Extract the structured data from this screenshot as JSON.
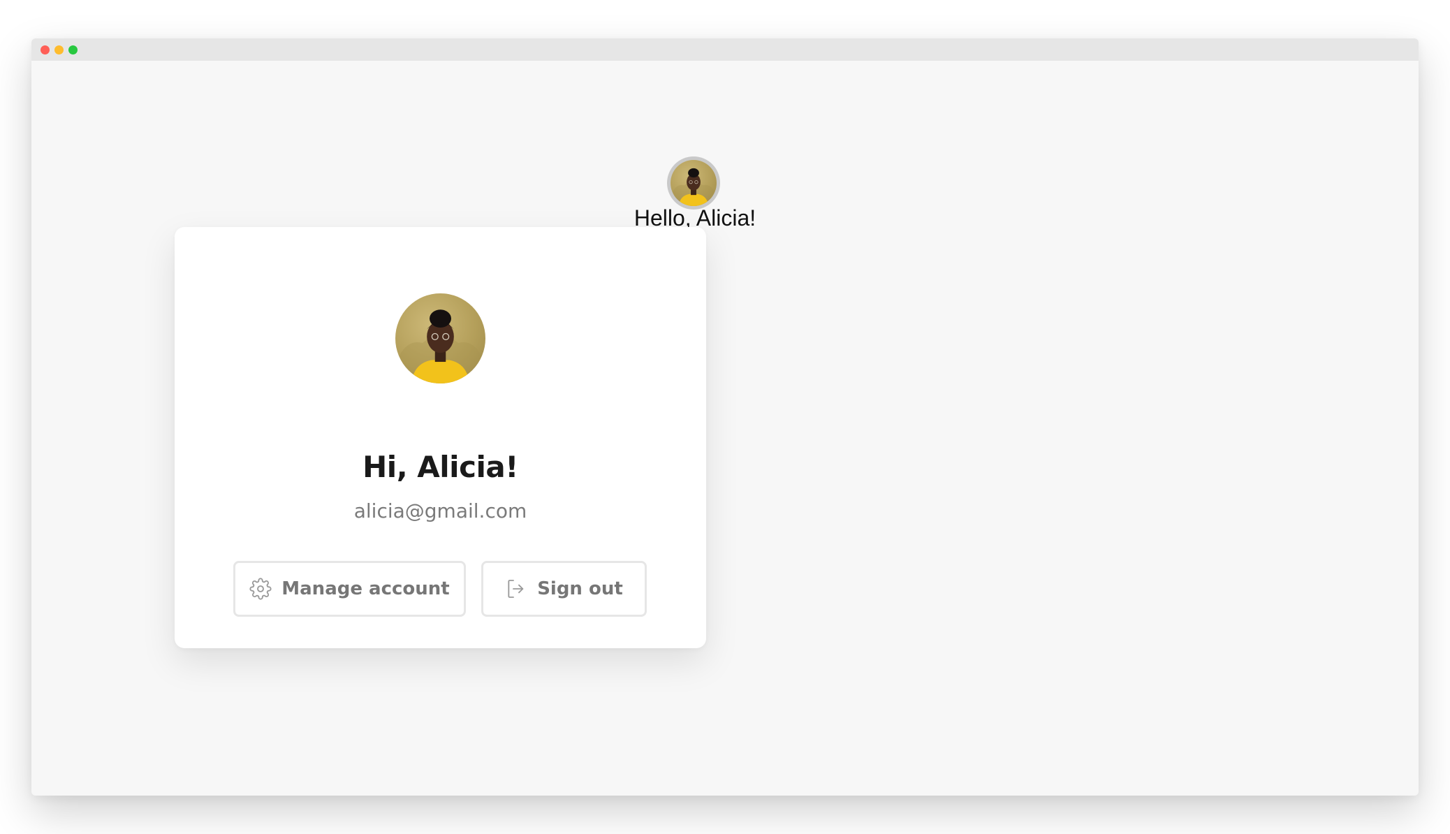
{
  "window": {
    "controls": [
      "close",
      "minimize",
      "zoom"
    ]
  },
  "header": {
    "avatar_alt": "Alicia",
    "greeting": "Hello, Alicia!"
  },
  "card": {
    "avatar_alt": "Alicia",
    "title": "Hi, Alicia!",
    "email": "alicia@gmail.com",
    "buttons": {
      "manage": {
        "label": "Manage account",
        "icon": "gear-icon"
      },
      "signout": {
        "label": "Sign out",
        "icon": "sign-out-icon"
      }
    }
  },
  "colors": {
    "background": "#f7f7f7",
    "titlebar": "#e6e6e6",
    "card": "#ffffff",
    "title_text": "#1a1a1a",
    "muted_text": "#7a7a7a",
    "button_border": "#e6e6e6"
  }
}
